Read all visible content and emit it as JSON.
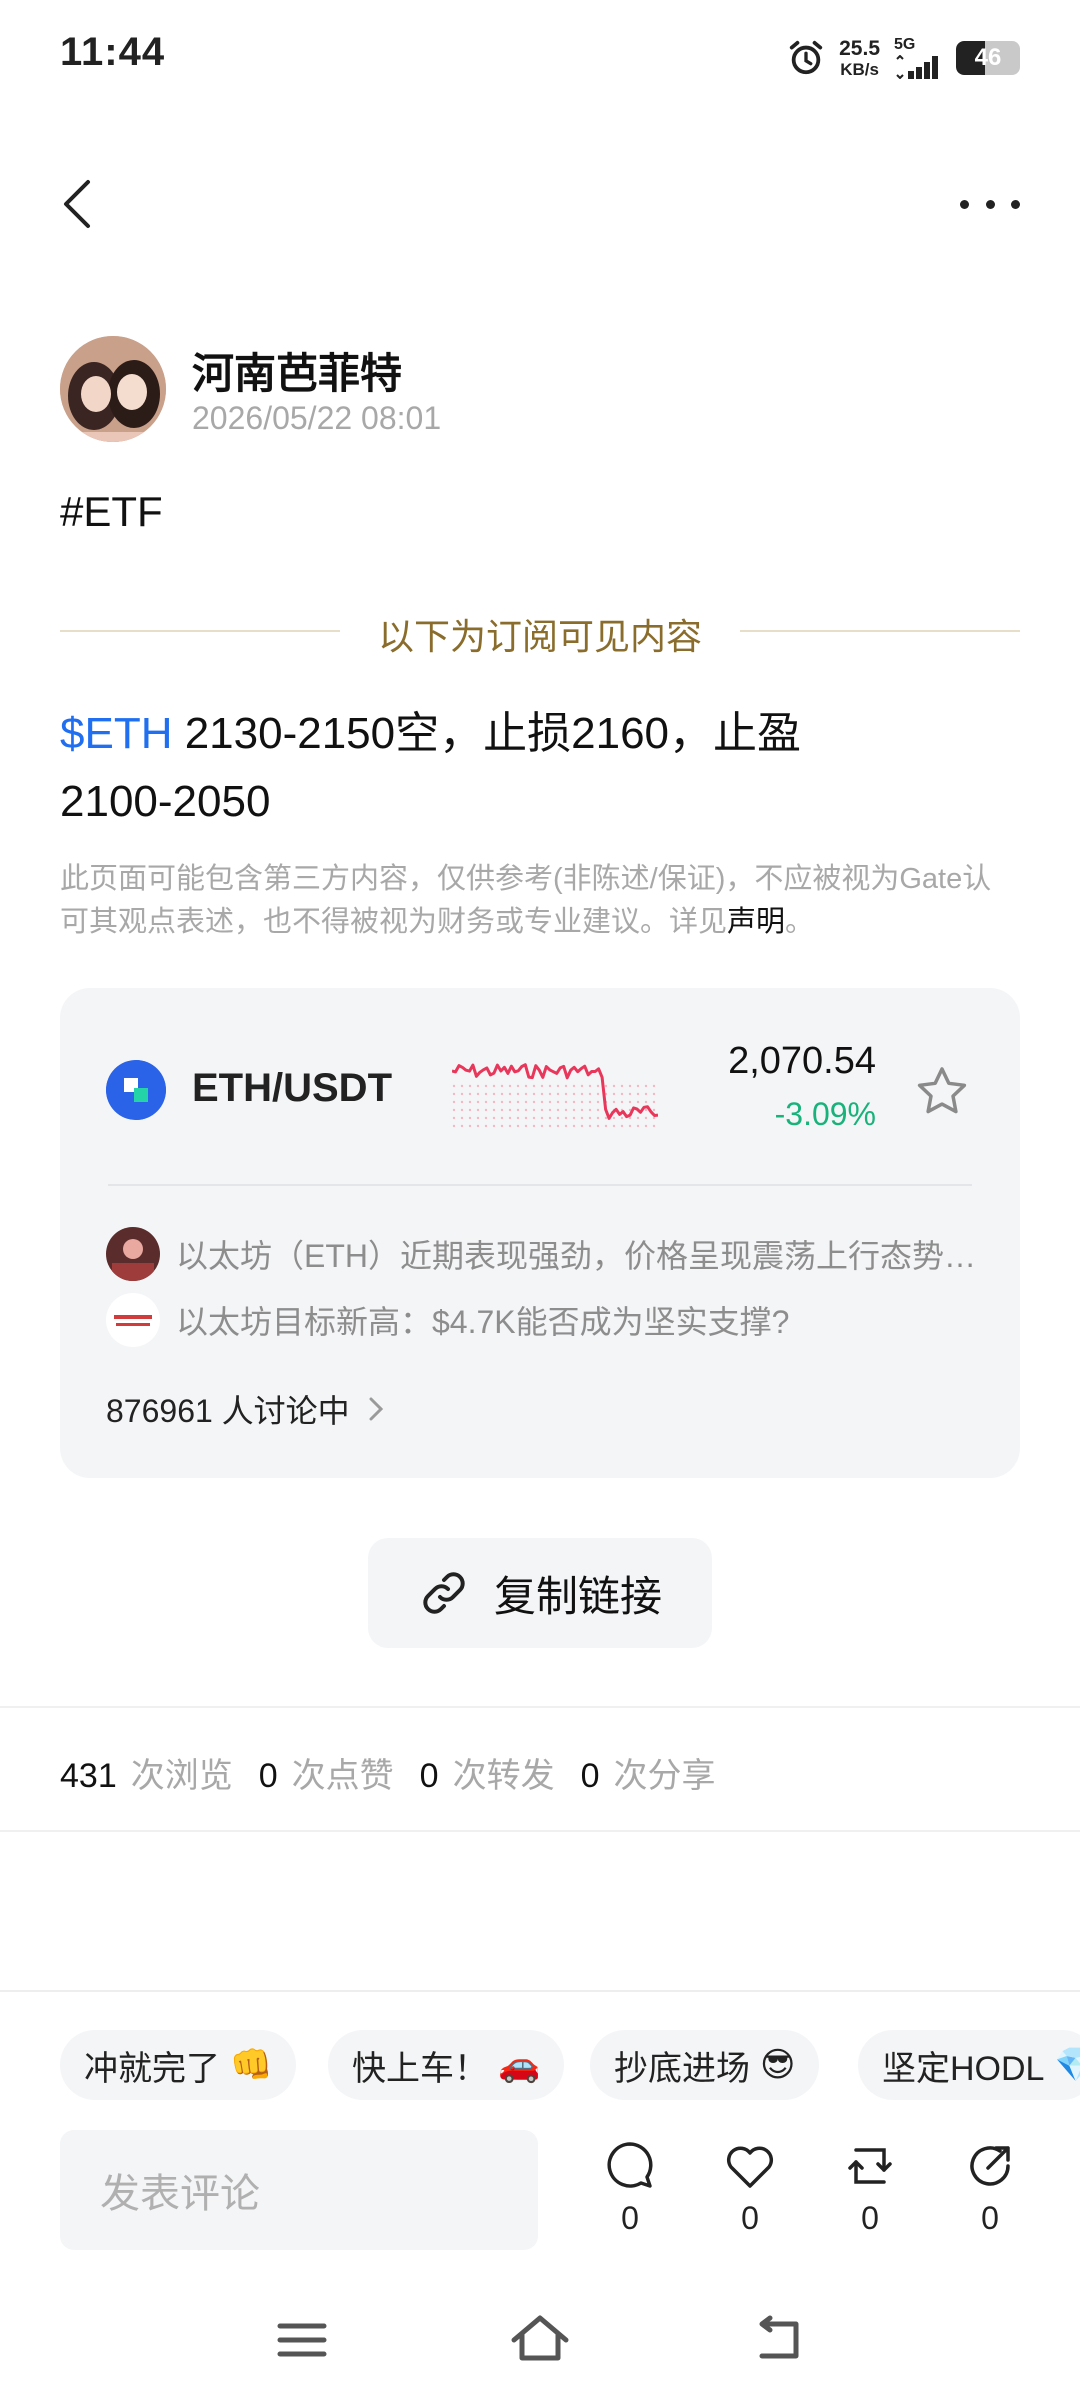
{
  "status_bar": {
    "time": "11:44",
    "net_speed_value": "25.5",
    "net_speed_unit": "KB/s",
    "network": "5G",
    "battery_level": "46",
    "battery_fraction": 0.46,
    "icons": [
      "alarm-icon",
      "signal-icon",
      "battery-icon"
    ]
  },
  "header": {
    "icons": [
      "back-icon",
      "more-icon"
    ]
  },
  "author": {
    "name": "河南芭菲特",
    "time": "2026/05/22 08:01"
  },
  "post": {
    "hashtag": "#ETF",
    "subscribe_divider": "以下为订阅可见内容",
    "ticker": "$ETH",
    "body_line1": " 2130-2150空，止损2160，止盈",
    "body_line2": "2100-2050",
    "disclaimer": "此页面可能包含第三方内容，仅供参考(非陈述/保证)，不应被视为Gate认可其观点表述，也不得被视为财务或专业建议。详见",
    "disclaimer_link": "声明",
    "disclaimer_end": "。"
  },
  "market_card": {
    "pair": "ETH/USDT",
    "price": "2,070.54",
    "change": "-3.09%",
    "colors": {
      "up": "#19b27b",
      "spark": "#e8375a",
      "coin": "#2a63e8"
    },
    "news": [
      "以太坊（ETH）近期表现强劲，价格呈现震荡上行态势，市场情绪明显回暖",
      "以太坊目标新高：$4.7K能否成为坚实支撑?"
    ],
    "discussing": "876961 人讨论中"
  },
  "copy_link": {
    "label": "复制链接"
  },
  "stats": {
    "views": "431",
    "views_label": "次浏览",
    "likes": "0",
    "likes_label": "次点赞",
    "reposts": "0",
    "reposts_label": "次转发",
    "shares": "0",
    "shares_label": "次分享"
  },
  "quick_reactions": [
    {
      "label": "冲就完了",
      "emoji": "👊"
    },
    {
      "label": "快上车！",
      "emoji": "🚗"
    },
    {
      "label": "抄底进场",
      "emoji": "😎"
    },
    {
      "label": "坚定HODL",
      "emoji": "💎"
    }
  ],
  "comment_bar": {
    "placeholder": "发表评论",
    "comment_count": "0",
    "like_count": "0",
    "repost_count": "0",
    "share_count": "0"
  },
  "system_nav": {
    "icons": [
      "menu-icon",
      "home-icon",
      "back-nav-icon"
    ]
  }
}
